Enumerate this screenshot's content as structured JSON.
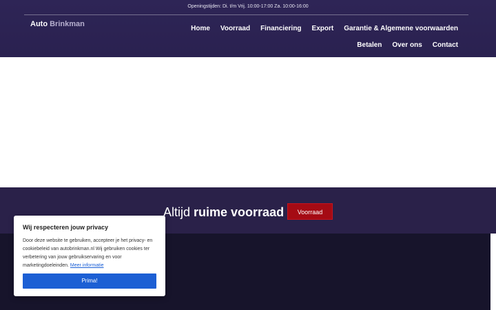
{
  "header": {
    "opening_hours": "Openingstijden: Di. t/m Vrij. 10:00-17:00 Za. 10:00-16:00",
    "logo_first": "Auto",
    "logo_second": "Brinkman"
  },
  "nav": {
    "row1": [
      "Home",
      "Voorraad",
      "Financiering",
      "Export",
      "Garantie & Algemene voorwaarden"
    ],
    "row2": [
      "Betalen",
      "Over ons",
      "Contact"
    ]
  },
  "promo": {
    "text_light": "Altijd",
    "text_bold": "ruime voorraad",
    "button_label": "Voorraad"
  },
  "cookie": {
    "title": "Wij respecteren jouw privacy",
    "body": "Door deze website te gebruiken, accepteer je het privacy- en cookiebeleid van autobrinkman.nl Wij gebruiken cookies ter verbetering van jouw gebruikservaring en voor marketingdoeleinden.",
    "link_label": "Meer informatie",
    "accept_label": "Prima!"
  },
  "colors": {
    "header_bg": "#2e2556",
    "promo_bg": "#2a2149",
    "dark_bg": "#17142b",
    "accent_red": "#a50b14",
    "accent_blue": "#1c5fd4"
  }
}
